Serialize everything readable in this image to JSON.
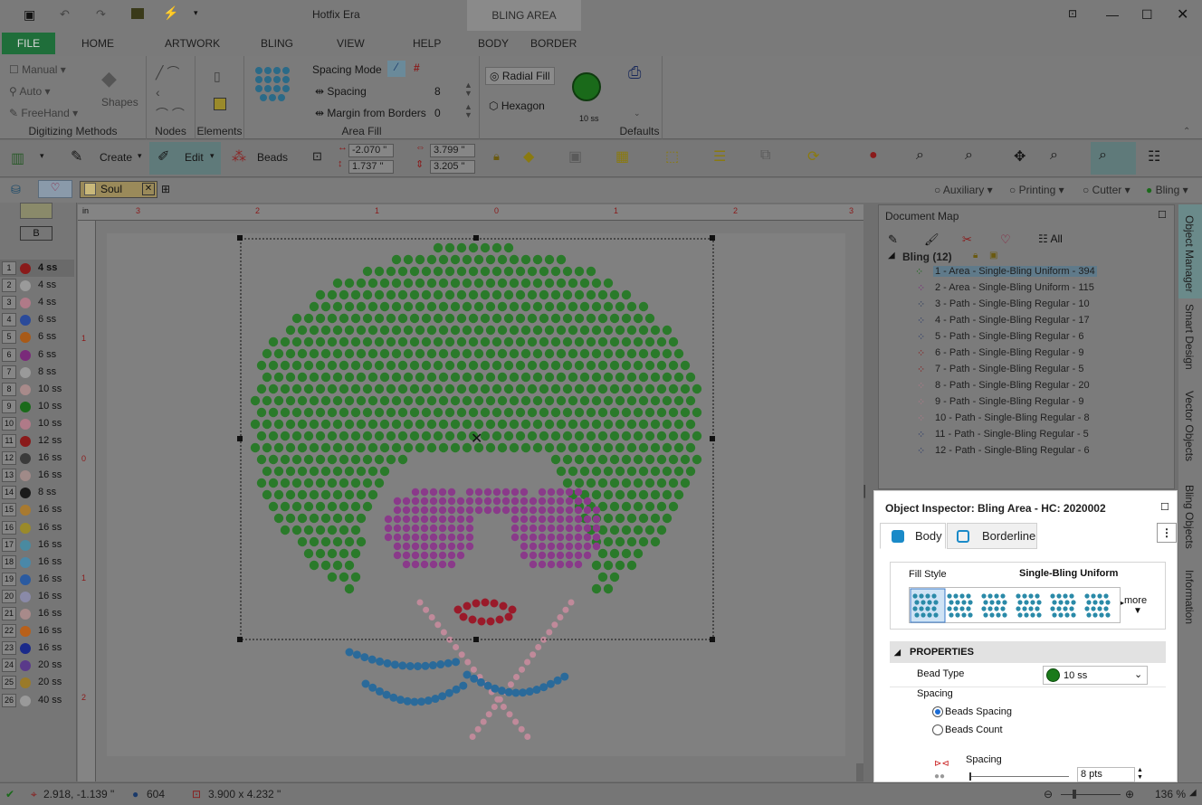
{
  "app": {
    "title": "Hotfix Era",
    "context_tab": "BLING AREA"
  },
  "tabs": {
    "file": "FILE",
    "items": [
      "HOME",
      "ARTWORK",
      "BLING",
      "VIEW",
      "HELP",
      "BODY",
      "BORDER"
    ]
  },
  "ribbon": {
    "digitizing": {
      "manual": "Manual",
      "auto": "Auto",
      "freehand": "FreeHand",
      "shapes": "Shapes",
      "label": "Digitizing Methods"
    },
    "nodes_label": "Nodes",
    "elements_label": "Elements",
    "area_fill": {
      "spacing_mode": "Spacing Mode",
      "spacing": "Spacing",
      "spacing_value": "8",
      "margin": "Margin from Borders",
      "margin_value": "0",
      "label": "Area Fill"
    },
    "fill": {
      "radial": "Radial Fill",
      "hexagon": "Hexagon",
      "bead": "10 ss"
    },
    "defaults_label": "Defaults"
  },
  "toolbar": {
    "create": "Create",
    "edit": "Edit",
    "beads": "Beads",
    "x": "-2.070 \"",
    "y": "1.737 \"",
    "w": "3.799 \"",
    "h": "3.205 \""
  },
  "doc": {
    "tab": "Soul",
    "filters": [
      "Auxiliary",
      "Printing",
      "Cutter",
      "Bling"
    ]
  },
  "palette": [
    {
      "n": "1",
      "ss": "4 ss",
      "c": "#8a1a1a"
    },
    {
      "n": "2",
      "ss": "4 ss",
      "c": "#9a9a9a"
    },
    {
      "n": "3",
      "ss": "4 ss",
      "c": "#b07a88"
    },
    {
      "n": "4",
      "ss": "6 ss",
      "c": "#2a4a9a"
    },
    {
      "n": "5",
      "ss": "6 ss",
      "c": "#a85a18"
    },
    {
      "n": "6",
      "ss": "6 ss",
      "c": "#7a2a7a"
    },
    {
      "n": "7",
      "ss": "8 ss",
      "c": "#9a9a9a"
    },
    {
      "n": "8",
      "ss": "10 ss",
      "c": "#a88a8a"
    },
    {
      "n": "9",
      "ss": "10 ss",
      "c": "#1a6a1a"
    },
    {
      "n": "10",
      "ss": "10 ss",
      "c": "#b07a88"
    },
    {
      "n": "11",
      "ss": "12 ss",
      "c": "#8a1a1a"
    },
    {
      "n": "12",
      "ss": "16 ss",
      "c": "#3a3a3a"
    },
    {
      "n": "13",
      "ss": "16 ss",
      "c": "#a08a88"
    },
    {
      "n": "14",
      "ss": "8 ss",
      "c": "#1a1a1a"
    },
    {
      "n": "15",
      "ss": "16 ss",
      "c": "#a87a30"
    },
    {
      "n": "16",
      "ss": "16 ss",
      "c": "#9a8a2a"
    },
    {
      "n": "17",
      "ss": "16 ss",
      "c": "#4a8aa0"
    },
    {
      "n": "18",
      "ss": "16 ss",
      "c": "#4a88a8"
    },
    {
      "n": "19",
      "ss": "16 ss",
      "c": "#2a5aa0"
    },
    {
      "n": "20",
      "ss": "16 ss",
      "c": "#8a8aa8"
    },
    {
      "n": "21",
      "ss": "16 ss",
      "c": "#a88a8a"
    },
    {
      "n": "22",
      "ss": "16 ss",
      "c": "#b8601a"
    },
    {
      "n": "23",
      "ss": "16 ss",
      "c": "#1a2a8a"
    },
    {
      "n": "24",
      "ss": "20 ss",
      "c": "#5a3a8a"
    },
    {
      "n": "25",
      "ss": "20 ss",
      "c": "#9a7a2a"
    },
    {
      "n": "26",
      "ss": "40 ss",
      "c": "#9a9a9a"
    }
  ],
  "ruler": {
    "h": [
      "3",
      "2",
      "1",
      "0",
      "1",
      "2",
      "3"
    ],
    "unit": "in",
    "v": [
      "1",
      "0",
      "1",
      "2"
    ]
  },
  "docmap": {
    "title": "Document Map",
    "all": "All",
    "group": "Bling (12)",
    "items": [
      "1 - Area - Single-Bling Uniform - 394",
      "2 - Area - Single-Bling Uniform - 115",
      "3 - Path - Single-Bling Regular - 10",
      "4 - Path - Single-Bling Regular - 17",
      "5 - Path - Single-Bling Regular - 6",
      "6 - Path - Single-Bling Regular - 9",
      "7 - Path - Single-Bling Regular - 5",
      "8 - Path - Single-Bling Regular - 20",
      "9 - Path - Single-Bling Regular - 9",
      "10 - Path - Single-Bling Regular - 8",
      "11 - Path - Single-Bling Regular - 5",
      "12 - Path - Single-Bling Regular - 6"
    ]
  },
  "sidetabs": [
    "Object Manager",
    "Smart Design",
    "Vector Objects",
    "Bling Objects",
    "Information"
  ],
  "inspector": {
    "title": "Object Inspector: Bling Area - HC: 2020002",
    "tab_body": "Body",
    "tab_border": "Borderline",
    "fill_style_label": "Fill Style",
    "fill_style_value": "Single-Bling Uniform",
    "more": "more",
    "props": "PROPERTIES",
    "bead_type_label": "Bead Type",
    "bead_type_value": "10 ss",
    "spacing_label": "Spacing",
    "beads_spacing": "Beads Spacing",
    "beads_count": "Beads Count",
    "spacing_sub": "Spacing",
    "spacing_value": "8 pts"
  },
  "status": {
    "coords": "2.918, -1.139 \"",
    "count": "604",
    "size": "3.900 x 4.232 \"",
    "zoom": "136 %"
  }
}
